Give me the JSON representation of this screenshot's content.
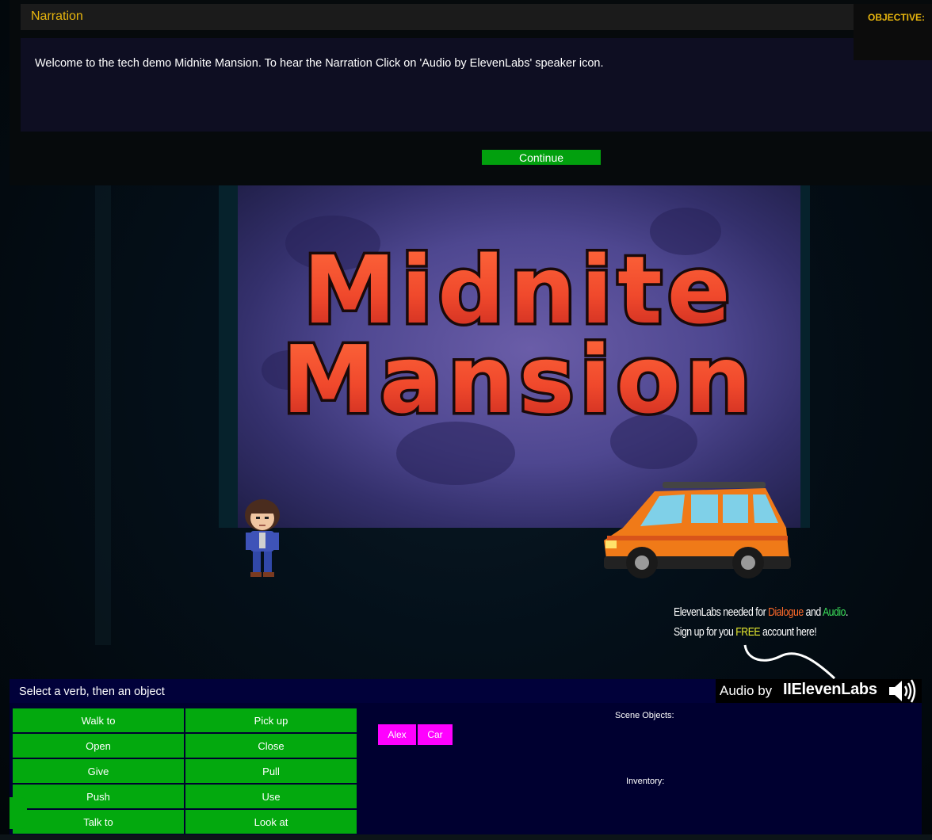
{
  "narration": {
    "title": "Narration",
    "text": "Welcome to the tech demo Midnite Mansion. To hear the Narration Click on 'Audio by ElevenLabs' speaker icon.",
    "continue_label": "Continue"
  },
  "objective": {
    "label": "OBJECTIVE:"
  },
  "scene": {
    "title_line1": "Midnite",
    "title_line2": "Mansion"
  },
  "promo": {
    "line1_prefix": "ElevenLabs needed for ",
    "line1_dialogue": "Dialogue",
    "line1_and": " and ",
    "line1_audio": "Audio",
    "line1_end": ".",
    "line2_prefix": "Sign up for you ",
    "line2_free": "FREE",
    "line2_suffix": " account here!"
  },
  "audio": {
    "audio_by": "Audio by",
    "brand": "IIElevenLabs"
  },
  "controls": {
    "prompt": "Select a verb, then an object",
    "verbs": [
      "Walk to",
      "Pick up",
      "Open",
      "Close",
      "Give",
      "Pull",
      "Push",
      "Use",
      "Talk to",
      "Look at"
    ],
    "scene_objects_label": "Scene Objects:",
    "scene_objects": [
      "Alex",
      "Car"
    ],
    "inventory_label": "Inventory:"
  },
  "colors": {
    "accent_yellow": "#e8b60e",
    "verb_green": "#03a90e",
    "object_magenta": "#ff00ff",
    "panel_navy": "#000030"
  }
}
